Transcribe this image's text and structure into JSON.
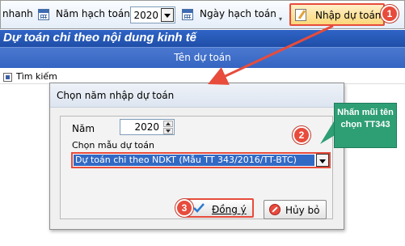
{
  "toolbar": {
    "left_text": "nhanh",
    "year_label": "Năm hạch toán",
    "year_value": "2020",
    "date_label": "Ngày hạch toán",
    "nhap_du_toan": "Nhập dự toán"
  },
  "main": {
    "title": "Dự toán chi theo nội dung kinh tế",
    "column_header": "Tên dự toán",
    "search_label": "Tìm kiếm"
  },
  "dialog": {
    "title": "Chọn năm nhập dự toán",
    "year_label": "Năm",
    "year_value": "2020",
    "template_label": "Chọn mẫu dự toán",
    "template_value": "Dự toán chi theo NDKT (Mẫu TT 343/2016/TT-BTC)",
    "ok_label": "Đồng ý",
    "cancel_label": "Hủy bỏ"
  },
  "annotations": {
    "callout_text": "Nhấn mũi tên chọn TT343",
    "step1": "1",
    "step2": "2",
    "step3": "3",
    "accent_color": "#e74c3c",
    "callout_color": "#2e9e75"
  }
}
